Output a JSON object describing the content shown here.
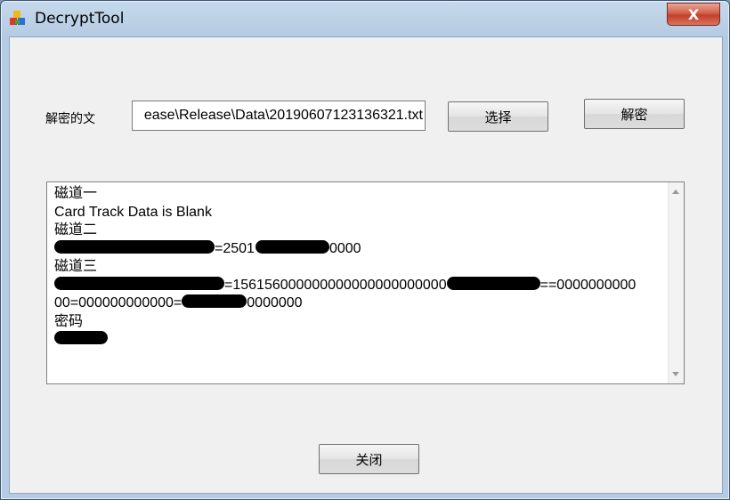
{
  "window": {
    "title": "DecryptTool",
    "close_glyph": "X"
  },
  "form": {
    "file_label": "解密的文",
    "file_path_visible": "ease\\Release\\Data\\20190607123136321.txt",
    "select_button": "选择",
    "decrypt_button": "解密"
  },
  "output": {
    "track1_heading": "磁道一",
    "track1_text": "Card Track Data is Blank",
    "track2_heading": "磁道二",
    "track2_mid": "=2501",
    "track2_end": "0000",
    "track3_heading": "磁道三",
    "track3_mid": "=156156000000000000000000000",
    "track3_end": "==0000000000",
    "track3_line2_start": "00=000000000000=",
    "track3_line2_end": "0000000",
    "password_heading": "密码"
  },
  "footer": {
    "close_button": "关闭"
  },
  "icons": {
    "app_icon": "app-cubes-icon",
    "scroll_up": "scroll-up-arrow-icon",
    "scroll_down": "scroll-down-arrow-icon"
  }
}
